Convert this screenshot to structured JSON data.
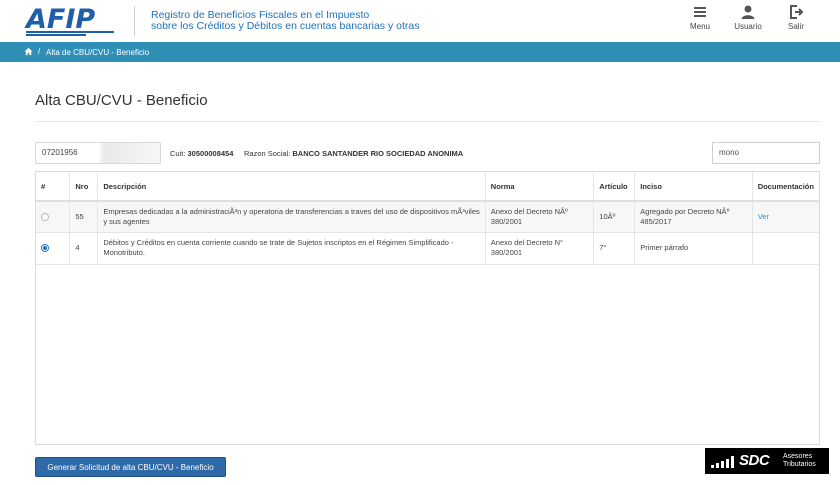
{
  "header": {
    "logo_text": "AFIP",
    "app_title_line1": "Registro de Beneficios Fiscales en el Impuesto",
    "app_title_line2": "sobre los Créditos y Débitos en cuentas bancarias y otras",
    "nav": {
      "menu": "Menu",
      "user": "Usuario",
      "exit": "Salir"
    }
  },
  "breadcrumb": {
    "separator": "/",
    "current": "Alta de CBU/CVU - Beneficio"
  },
  "page": {
    "title": "Alta CBU/CVU - Beneficio"
  },
  "filters": {
    "cbu_value": "07201956",
    "cuit_label": "Cuit:",
    "cuit_value": "30500008454",
    "razon_label": "Razon Social:",
    "razon_value": "BANCO SANTANDER RIO SOCIEDAD ANONIMA",
    "search_value": "mono"
  },
  "table": {
    "headers": [
      "#",
      "Nro",
      "Descripción",
      "Norma",
      "Artículo",
      "Inciso",
      "Documentación"
    ],
    "rows": [
      {
        "selected": false,
        "nro": "55",
        "descripcion": "Empresas dedicadas a la administraciÃ³n y operatoria de transferencias a traves del uso de dispositivos mÃ³viles y sus agentes",
        "norma": "Anexo del Decreto NÂº 380/2001",
        "articulo": "10Âº",
        "inciso": "Agregado por Decreto NÂº 485/2017",
        "documentacion": "Ver"
      },
      {
        "selected": true,
        "nro": "4",
        "descripcion": "Débitos y Créditos en cuenta corriente cuando se trate de Sujetos inscriptos en el Régimen Simplificado - Monotributo.",
        "norma": "Anexo del Decreto N° 380/2001",
        "articulo": "7°",
        "inciso": "Primer párrafo",
        "documentacion": ""
      }
    ]
  },
  "footer": {
    "generate_button": "Generar Solicitud de alta CBU/CVU - Beneficio",
    "sdc_big": "SDC",
    "sdc_line1": "Asesores",
    "sdc_line2": "Tributarios"
  },
  "colors": {
    "brand_blue": "#1f72b8",
    "crumb_bar": "#2f8fb7",
    "button": "#2f6aa8"
  }
}
